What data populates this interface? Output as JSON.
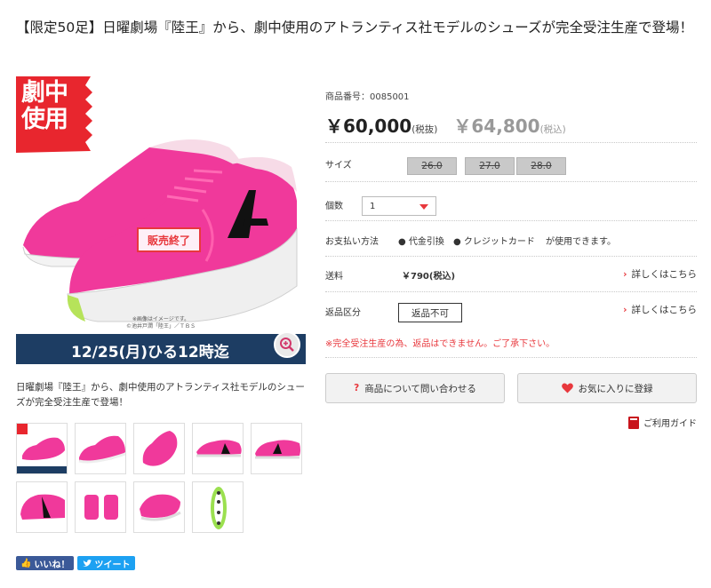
{
  "title": "【限定50足】日曜劇場『陸王』から、劇中使用のアトランティス社モデルのシューズが完全受注生産で登場！",
  "main_image": {
    "badge_line1": "劇中",
    "badge_line2": "使用",
    "soldout_label": "販売終了",
    "note_line1": "※画像はイメージです。",
    "note_line2": "©池井戸潤「陸王」／ＴＢＳ",
    "deadline": "12/25(月)ひる12時迄",
    "zoom_icon": "zoom-in-icon"
  },
  "description": "日曜劇場『陸王』から、劇中使用のアトランティス社モデルのシューズが完全受注生産で登場！",
  "thumbnails": [
    "thumb-1",
    "thumb-2",
    "thumb-3",
    "thumb-4",
    "thumb-5",
    "thumb-6",
    "thumb-7",
    "thumb-8",
    "thumb-9"
  ],
  "social": {
    "like_label": "いいね！",
    "tweet_label": "ツイート"
  },
  "product": {
    "product_no": "商品番号：0085001",
    "price": "￥60,000",
    "price_tax_note": "(税抜)",
    "price_incl": "￥64,800",
    "price_incl_note": "(税込)"
  },
  "size": {
    "label": "サイズ",
    "options": [
      "26.0",
      "27.0",
      "28.0"
    ]
  },
  "quantity": {
    "label": "個数",
    "value": "1"
  },
  "payment": {
    "label": "お支払い方法",
    "method1": "代金引換",
    "method2": "クレジットカード",
    "suffix": "が使用できます。"
  },
  "shipping": {
    "label": "送料",
    "value": "￥790(税込)",
    "link": "詳しくはこちら"
  },
  "returns": {
    "label": "返品区分",
    "value": "返品不可",
    "link": "詳しくはこちら"
  },
  "notice": "※完全受注生産の為、返品はできません。ご了承下さい。",
  "buttons": {
    "inquiry": "商品について問い合わせる",
    "favorite": "お気に入りに登録"
  },
  "guide_link": "ご利用ガイド",
  "colors": {
    "accent": "#e8383d",
    "navy": "#1d3d63",
    "shoe_pink": "#f0399b"
  }
}
